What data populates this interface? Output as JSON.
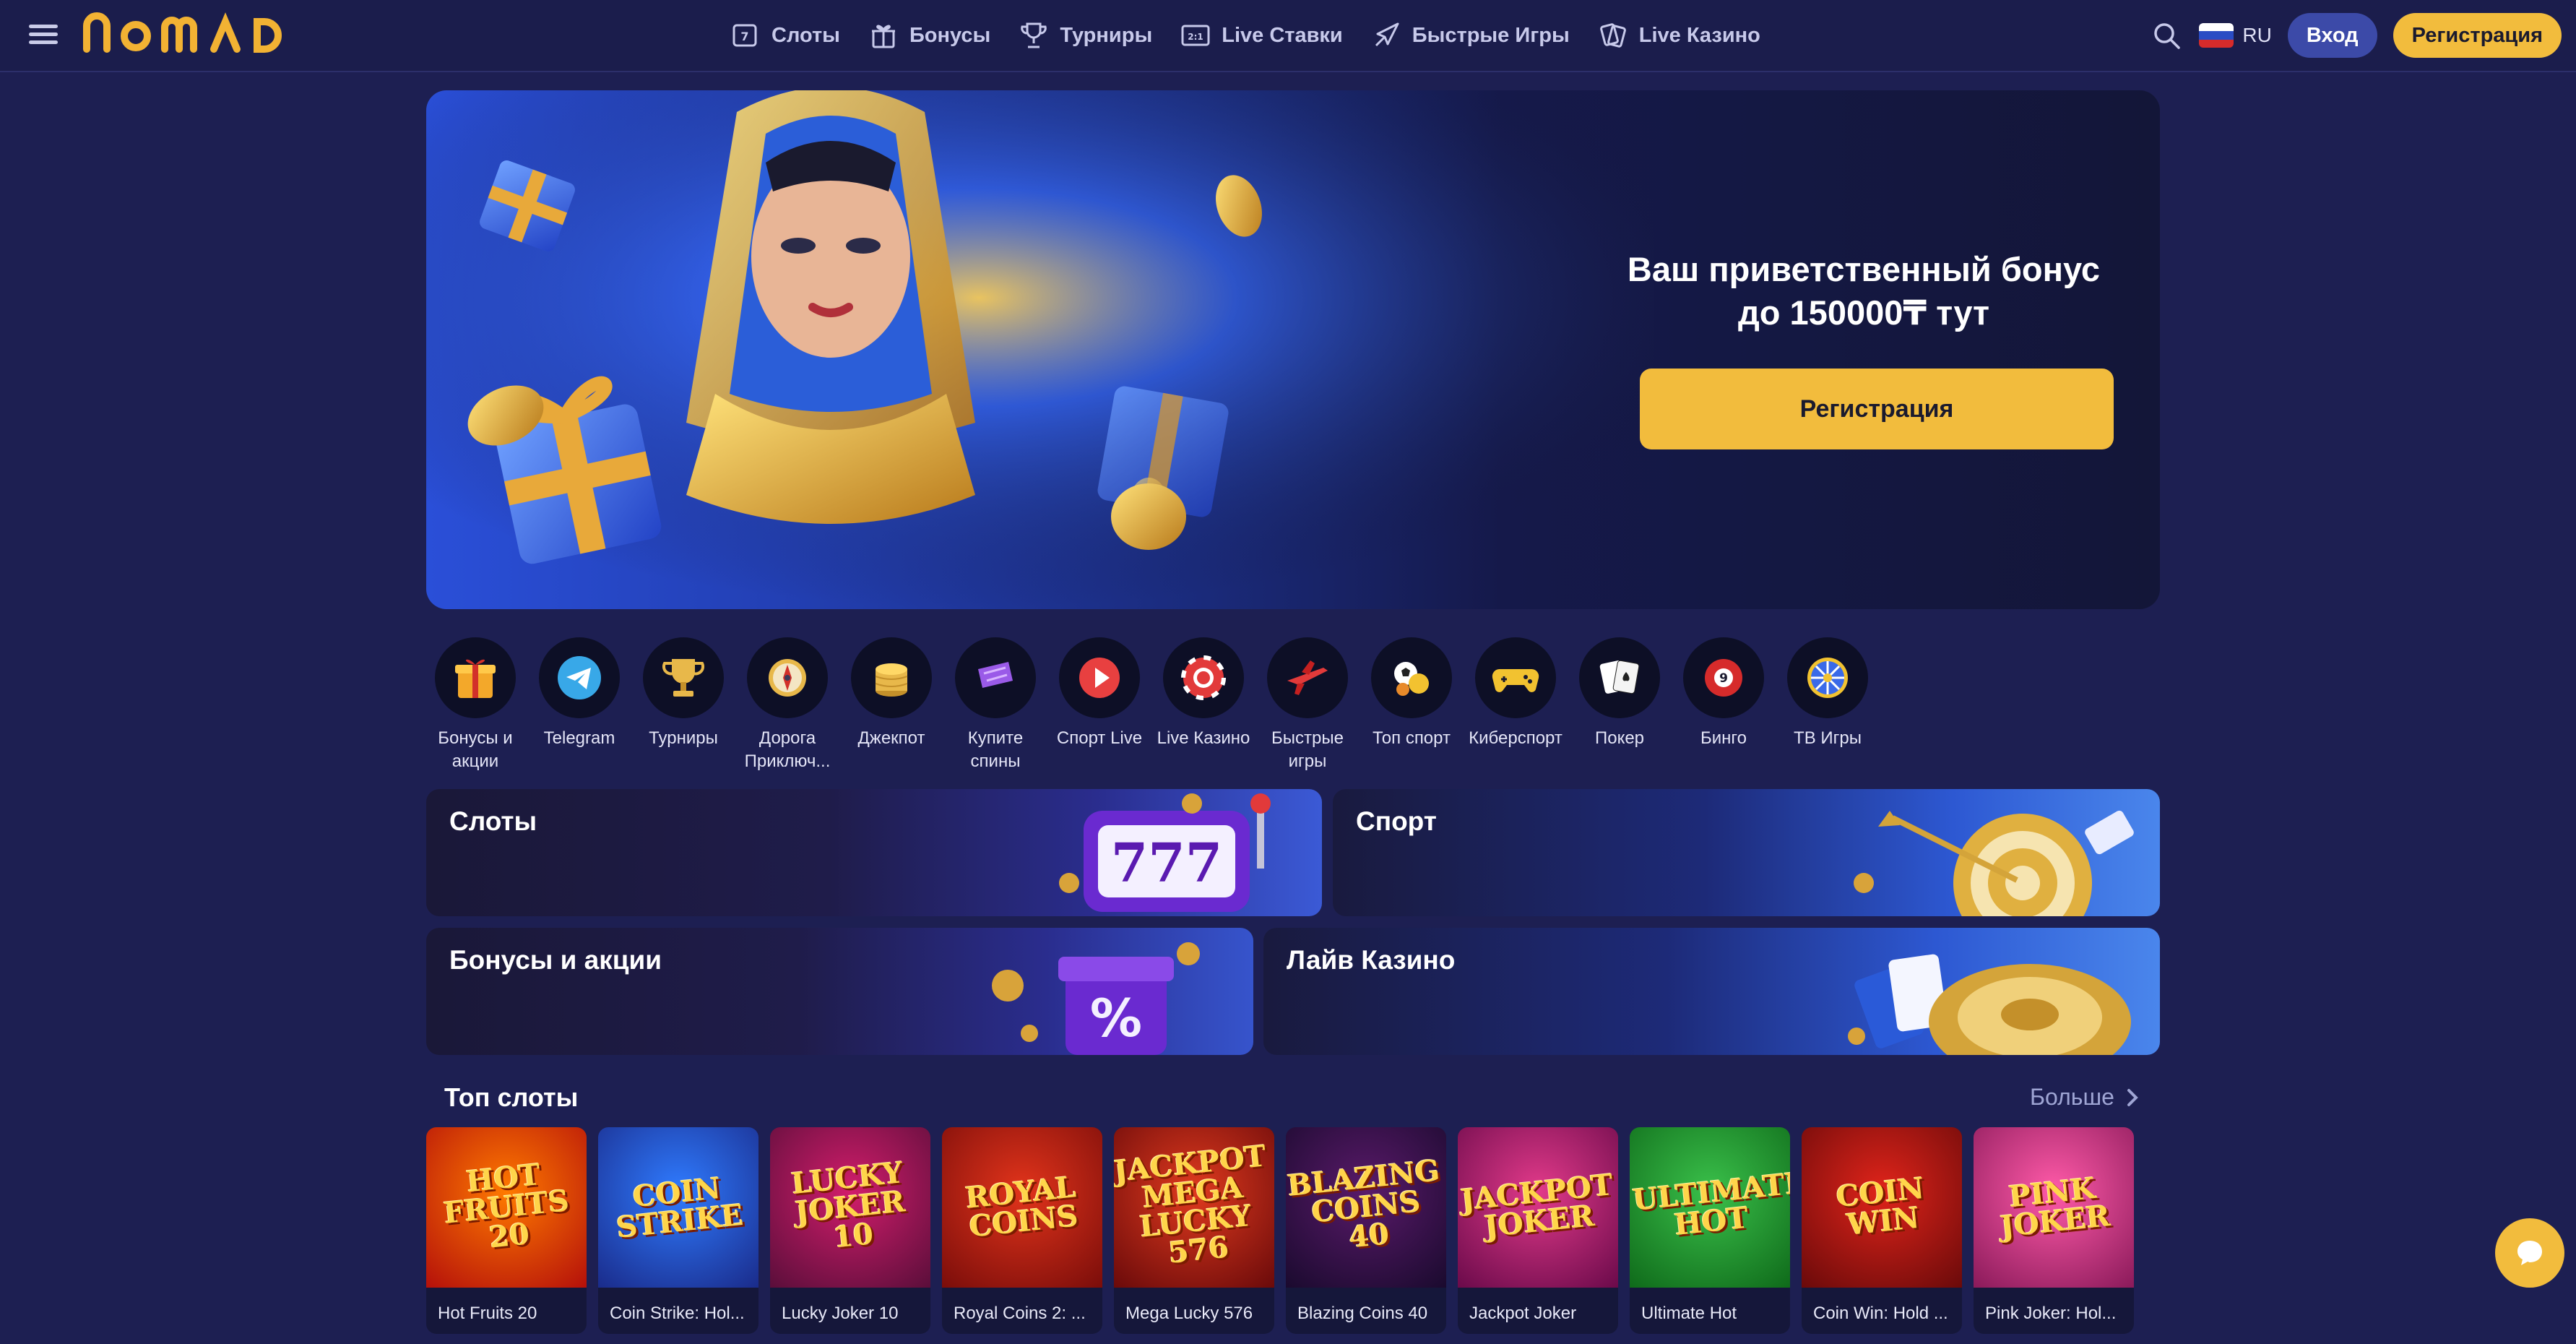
{
  "brand": {
    "logo_text": "nomad",
    "accent": "#f2bc3d"
  },
  "header": {
    "nav": [
      {
        "label": "Слоты",
        "icon": "slot-icon"
      },
      {
        "label": "Бонусы",
        "icon": "gift-icon"
      },
      {
        "label": "Турниры",
        "icon": "trophy-icon"
      },
      {
        "label": "Live Ставки",
        "icon": "live-bets-icon"
      },
      {
        "label": "Быстрые Игры",
        "icon": "rocket-icon"
      },
      {
        "label": "Live Казино",
        "icon": "cards-icon"
      }
    ],
    "language": "RU",
    "login_label": "Вход",
    "register_label": "Регистрация"
  },
  "hero": {
    "line1": "Ваш приветственный бонус",
    "line2": "до 150000₸ тут",
    "button_label": "Регистрация"
  },
  "categories": [
    {
      "label": "Бонусы и акции",
      "icon": "gift-box-icon"
    },
    {
      "label": "Telegram",
      "icon": "telegram-icon"
    },
    {
      "label": "Турниры",
      "icon": "cup-icon"
    },
    {
      "label": "Дорога Приключ...",
      "icon": "compass-icon"
    },
    {
      "label": "Джекпот",
      "icon": "coins-stack-icon"
    },
    {
      "label": "Купите спины",
      "icon": "ticket-icon"
    },
    {
      "label": "Спорт Live",
      "icon": "play-icon"
    },
    {
      "label": "Live Казино",
      "icon": "casino-chip-icon"
    },
    {
      "label": "Быстрые игры",
      "icon": "plane-icon"
    },
    {
      "label": "Топ спорт",
      "icon": "sport-balls-icon"
    },
    {
      "label": "Киберспорт",
      "icon": "gamepad-icon"
    },
    {
      "label": "Покер",
      "icon": "poker-cards-icon"
    },
    {
      "label": "Бинго",
      "icon": "bingo-ball-icon"
    },
    {
      "label": "ТВ Игры",
      "icon": "wheel-icon"
    }
  ],
  "tiles": {
    "slots": "Слоты",
    "sport": "Спорт",
    "bonuses": "Бонусы и акции",
    "live_casino": "Лайв Казино"
  },
  "top_slots": {
    "title": "Топ слоты",
    "more_label": "Больше",
    "games": [
      {
        "name": "Hot Fruits 20",
        "art": "HOT FRUITS 20",
        "bg1": "#ff7a00",
        "bg2": "#b4100a"
      },
      {
        "name": "Coin Strike: Hol...",
        "art": "COIN STRIKE",
        "bg1": "#2f7bff",
        "bg2": "#1a2b8a"
      },
      {
        "name": "Lucky Joker 10",
        "art": "LUCKY JOKER 10",
        "bg1": "#d21d6b",
        "bg2": "#5a0e3a"
      },
      {
        "name": "Royal Coins 2: ...",
        "art": "ROYAL COINS",
        "bg1": "#e2341b",
        "bg2": "#7a0d0a"
      },
      {
        "name": "Mega Lucky 576",
        "art": "JACKPOT MEGA LUCKY 576",
        "bg1": "#e03a1e",
        "bg2": "#6a0a0a"
      },
      {
        "name": "Blazing Coins 40",
        "art": "BLAZING COINS 40",
        "bg1": "#5a1a6a",
        "bg2": "#1a0a2e"
      },
      {
        "name": "Jackpot Joker",
        "art": "JACKPOT JOKER",
        "bg1": "#e23a8a",
        "bg2": "#6a0a4a"
      },
      {
        "name": "Ultimate Hot",
        "art": "ULTIMATE HOT",
        "bg1": "#3ac04a",
        "bg2": "#0f6a1a"
      },
      {
        "name": "Coin Win: Hold ...",
        "art": "COIN WIN",
        "bg1": "#e0241a",
        "bg2": "#6a0a0a"
      },
      {
        "name": "Pink Joker: Hol...",
        "art": "PINK JOKER",
        "bg1": "#ff5aa8",
        "bg2": "#8a1a5a"
      }
    ]
  }
}
